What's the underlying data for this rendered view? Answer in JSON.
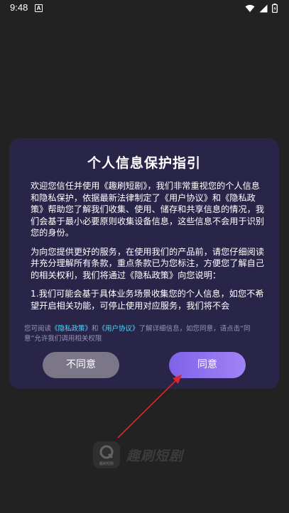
{
  "status_bar": {
    "time": "9:48",
    "notification_icon": "A"
  },
  "dialog": {
    "title": "个人信息保护指引",
    "paragraphs": [
      "欢迎您信任并使用《趣刷短剧》，我们非常重视您的个人信息和隐私保护，依据最新法律制定了《用户协议》和《隐私政策》帮助您了解我们收集、使用、储存和共享信息的情况，我们会基于最小必要原则收集设备信息，这些信息不会用于识别您的身份。",
      "为向您提供更好的服务，在使用我们的产品前，请您仔细阅读并充分理解所有条款，重点条款已为您标注，方便您了解自己的相关权利，我们将通过《隐私政策》向您说明：",
      "1.我们可能会基于具体业务场景收集您的个人信息，如您不希望开启相关功能，可停止使用对应服务，我们将不会"
    ],
    "notice": {
      "prefix": "您可阅读",
      "privacy_link": "《隐私政策》",
      "and": "和",
      "user_link": "《用户协议》",
      "suffix": "了解详细信息，如您同意，请点击“同意”允许我们调用相关权限"
    },
    "disagree_label": "不同意",
    "agree_label": "同意"
  },
  "app": {
    "logo_label": "趣刷短剧",
    "name": "趣刷短剧"
  },
  "colors": {
    "background": "#222222",
    "dialog": "#292548",
    "link": "#58d6ff",
    "agree_button": "#8f74ee",
    "disagree_button": "#7b7688",
    "annotation_arrow": "#d9262c"
  }
}
